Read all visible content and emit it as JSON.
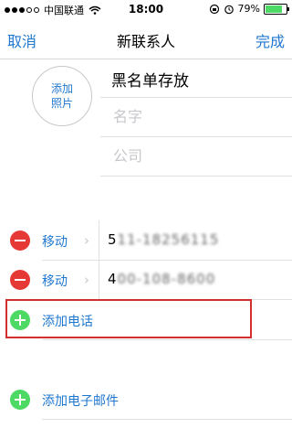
{
  "status": {
    "carrier": "中国联通",
    "time": "18:00",
    "battery_pct": "79%"
  },
  "nav": {
    "cancel": "取消",
    "title": "新联系人",
    "done": "完成"
  },
  "photo": {
    "line1": "添加",
    "line2": "照片"
  },
  "name_fields": {
    "first_value": "黑名单存放",
    "last_placeholder": "名字",
    "company_placeholder": "公司"
  },
  "phones": [
    {
      "label": "移动",
      "lead": "5",
      "masked": "11-18256115"
    },
    {
      "label": "移动",
      "lead": "4",
      "masked": "00-108-8600"
    }
  ],
  "actions": {
    "add_phone": "添加电话",
    "add_email": "添加电子邮件"
  },
  "colors": {
    "accent": "#1f77d0",
    "delete": "#e53935",
    "add": "#4cd964",
    "highlight": "#d32f2f"
  }
}
